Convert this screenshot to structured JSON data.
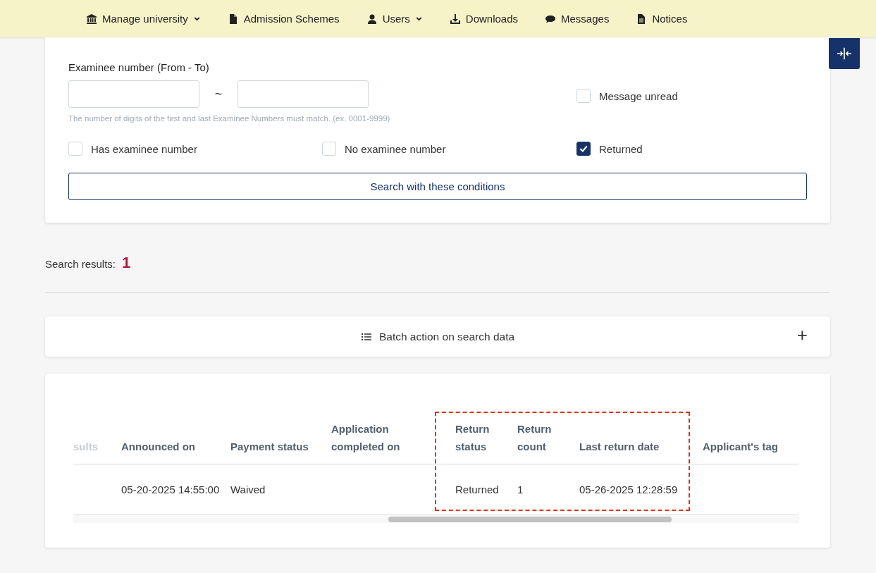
{
  "nav": [
    {
      "label": "Manage university",
      "has_menu": true
    },
    {
      "label": "Admission Schemes",
      "has_menu": false
    },
    {
      "label": "Users",
      "has_menu": true
    },
    {
      "label": "Downloads",
      "has_menu": false
    },
    {
      "label": "Messages",
      "has_menu": false
    },
    {
      "label": "Notices",
      "has_menu": false
    }
  ],
  "filters": {
    "examinee_label": "Examinee number (From - To)",
    "range_separator": "~",
    "hint": "The number of digits of the first and last Examinee Numbers must match. (ex. 0001-9999)",
    "side_checkbox": {
      "label": "Message unread",
      "checked": false
    },
    "checkboxes": [
      {
        "label": "Has examinee number",
        "checked": false
      },
      {
        "label": "No examinee number",
        "checked": false
      },
      {
        "label": "Returned",
        "checked": true
      }
    ],
    "search_button": "Search with these conditions"
  },
  "results": {
    "label": "Search results:",
    "count": "1"
  },
  "batch": {
    "label": "Batch action on search data",
    "expand": "+"
  },
  "table": {
    "columns": [
      "sults",
      "Announced on",
      "Payment status",
      "Application completed on",
      "Return status",
      "Return count",
      "Last return date",
      "Applicant's tag"
    ],
    "rows": [
      [
        "",
        "05-20-2025 14:55:00",
        "Waived",
        "",
        "Returned",
        "1",
        "05-26-2025 12:28:59",
        ""
      ]
    ]
  }
}
